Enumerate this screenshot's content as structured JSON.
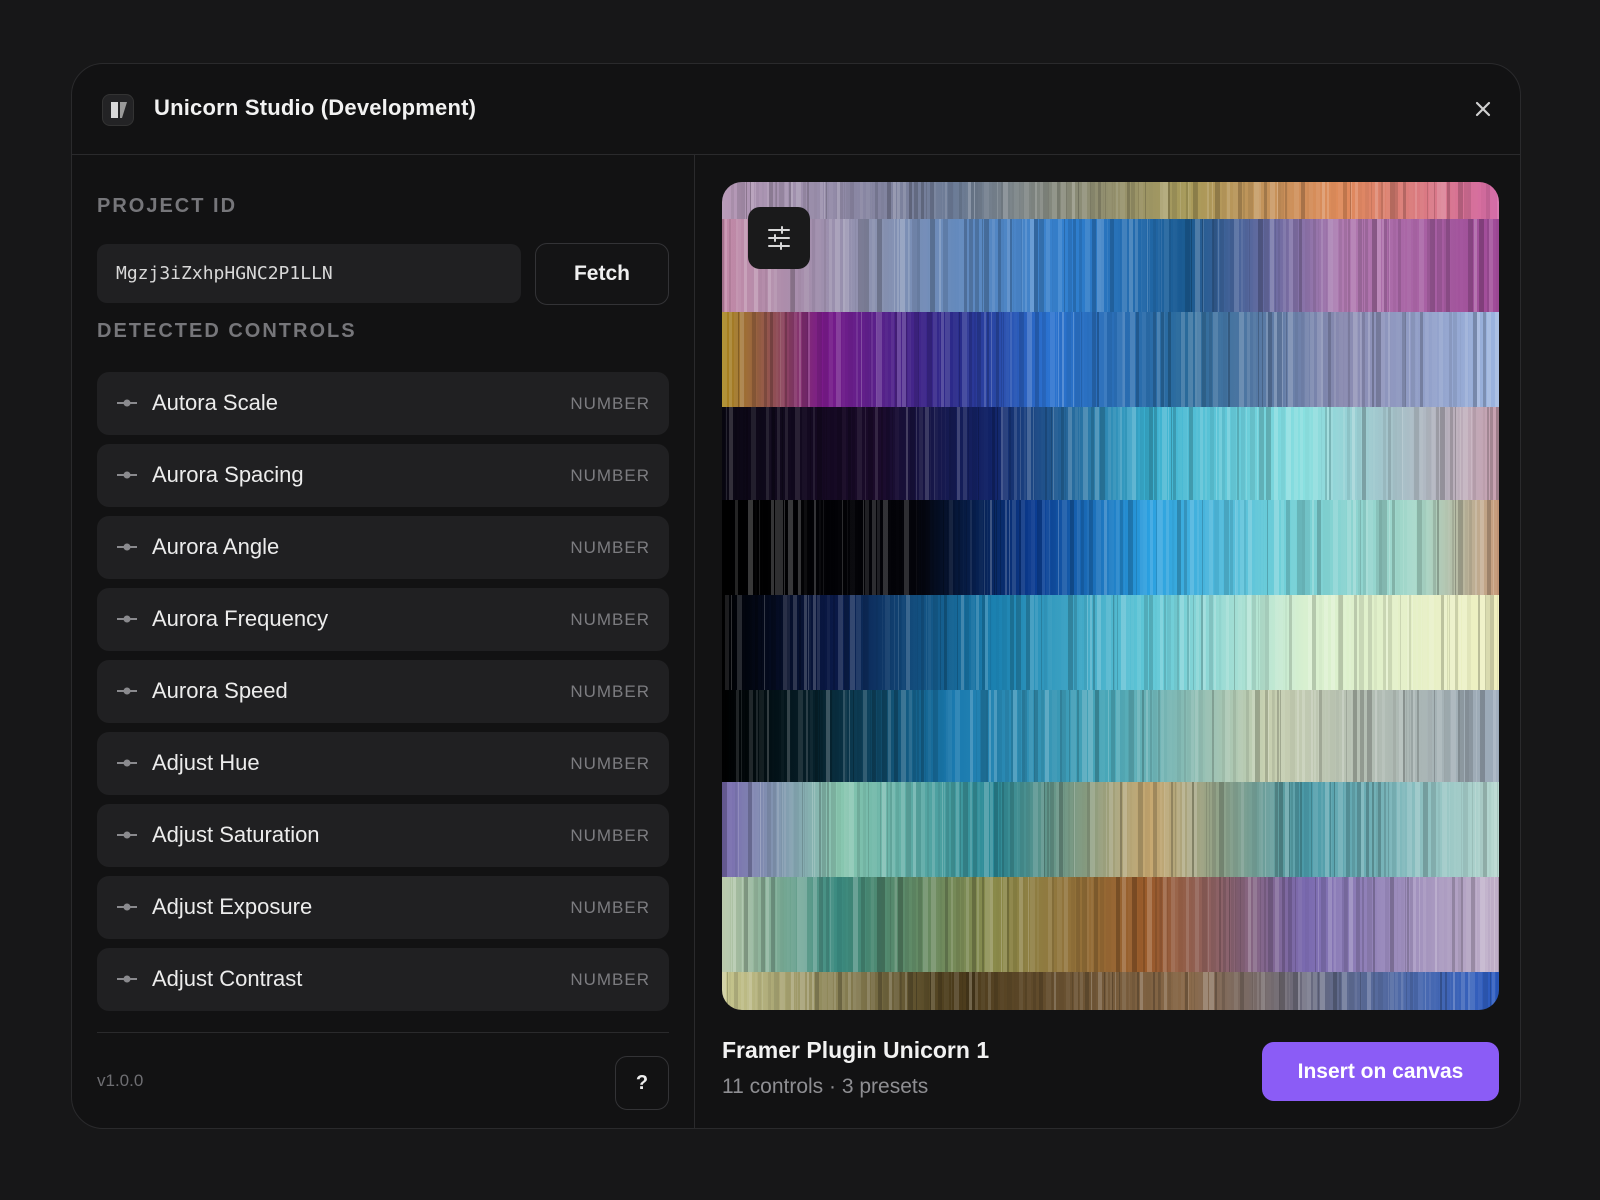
{
  "window": {
    "title": "Unicorn Studio (Development)"
  },
  "project": {
    "section_label": "PROJECT ID",
    "id_value": "Mgzj3iZxhpHGNC2P1LLN",
    "fetch_label": "Fetch"
  },
  "controls": {
    "section_label": "DETECTED CONTROLS",
    "items": [
      {
        "label": "Autora Scale",
        "type": "NUMBER"
      },
      {
        "label": "Aurora Spacing",
        "type": "NUMBER"
      },
      {
        "label": "Aurora Angle",
        "type": "NUMBER"
      },
      {
        "label": "Aurora Frequency",
        "type": "NUMBER"
      },
      {
        "label": "Aurora Speed",
        "type": "NUMBER"
      },
      {
        "label": "Adjust Hue",
        "type": "NUMBER"
      },
      {
        "label": "Adjust Saturation",
        "type": "NUMBER"
      },
      {
        "label": "Adjust Exposure",
        "type": "NUMBER"
      },
      {
        "label": "Adjust Contrast",
        "type": "NUMBER"
      }
    ]
  },
  "footer": {
    "version": "v1.0.0",
    "help_label": "?"
  },
  "preview": {
    "name": "Framer Plugin Unicorn 1",
    "meta": "11 controls · 3 presets",
    "insert_label": "Insert on canvas"
  },
  "icons": {
    "app": "unicorn-logo-icon",
    "close": "close-icon",
    "control": "slider-handle-icon",
    "settings": "sliders-icon"
  },
  "colors": {
    "accent": "#8b5cf6",
    "background": "#171718",
    "panel": "#121213",
    "row": "#202022"
  }
}
